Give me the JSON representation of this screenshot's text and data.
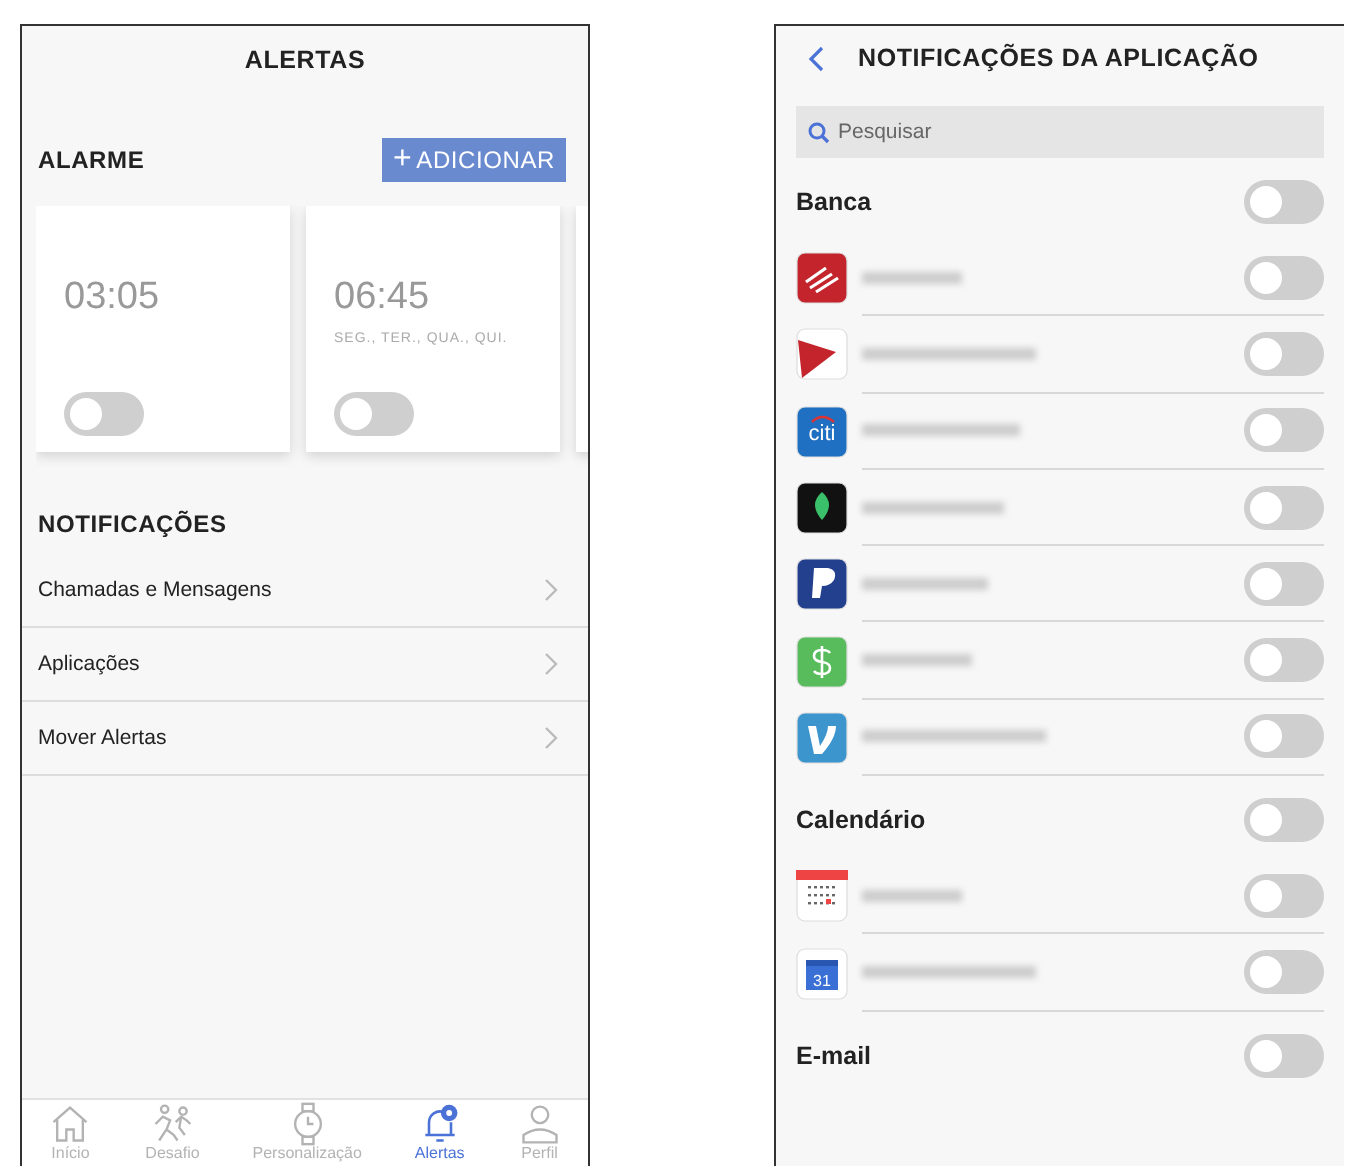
{
  "alerts_screen": {
    "title": "ALERTAS",
    "alarm_section": {
      "title": "ALARME",
      "add_button": {
        "icon": "+",
        "label": "ADICIONAR"
      }
    },
    "alarms": [
      {
        "time": "03:05",
        "on": false
      },
      {
        "time": "06:45",
        "days": "SEG., TER., QUA., QUI.",
        "on": false
      }
    ],
    "notifications_section": {
      "title": "NOTIFICAÇÕES"
    },
    "notification_items": [
      {
        "label": "Chamadas e Mensagens"
      },
      {
        "label": "Aplicações"
      },
      {
        "label": "Mover Alertas"
      }
    ],
    "tab_bar": [
      {
        "kind": "home",
        "label": "Início",
        "selected": false
      },
      {
        "kind": "run",
        "label": "Desafio",
        "selected": false
      },
      {
        "kind": "watch",
        "label": "Personalização",
        "selected": false
      },
      {
        "kind": "bell",
        "label": "Alertas",
        "selected": true
      },
      {
        "kind": "person",
        "label": "Perfil",
        "selected": false
      }
    ]
  },
  "app_notifications_screen": {
    "title": "NOTIFICAÇÕES DA APLICAÇÃO",
    "search": {
      "placeholder": "Pesquisar"
    },
    "groups": [
      {
        "title": "Banca",
        "on": false,
        "apps": [
          {
            "kind": "bank",
            "on": false
          },
          {
            "kind": "swoosh",
            "on": false
          },
          {
            "kind": "citi",
            "icon_text": "citi",
            "on": false
          },
          {
            "kind": "leaf",
            "on": false
          },
          {
            "kind": "paypal",
            "on": false
          },
          {
            "kind": "cash",
            "on": false
          },
          {
            "kind": "venmo",
            "on": false
          }
        ]
      },
      {
        "title": "Calendário",
        "on": false,
        "apps": [
          {
            "kind": "calendar",
            "on": false
          },
          {
            "kind": "gcal",
            "icon_text": "31",
            "on": false
          }
        ]
      },
      {
        "title": "E-mail",
        "on": false
      }
    ]
  }
}
